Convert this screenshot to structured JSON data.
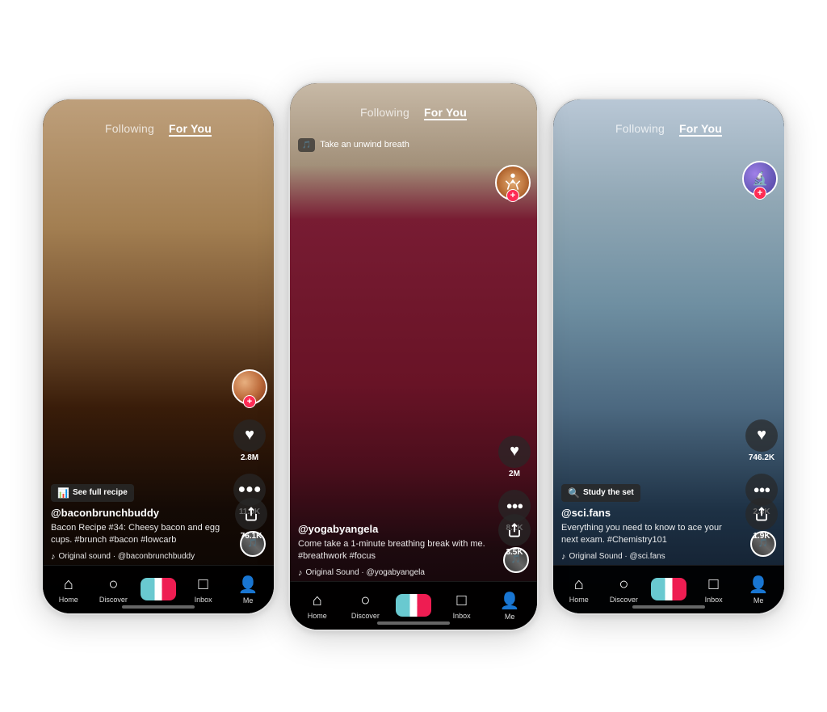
{
  "phones": [
    {
      "id": "phone-left",
      "theme": "egg",
      "nav": {
        "following": "Following",
        "for_you": "For You",
        "active": "for_you"
      },
      "sidebar": {
        "likes": "2.8M",
        "comments": "11.0K",
        "shares": "76.1K"
      },
      "content": {
        "badge": "See full recipe",
        "username": "@baconbrunchbuddy",
        "description": "Bacon Recipe #34: Cheesy bacon and egg cups. #brunch #bacon #lowcarb",
        "sound": "Original sound · @baconbrunchbuddy"
      },
      "bottomnav": [
        "Home",
        "Discover",
        "+",
        "Inbox",
        "Me"
      ]
    },
    {
      "id": "phone-middle",
      "theme": "yoga",
      "nav": {
        "following": "Following",
        "for_you": "For You",
        "active": "for_you"
      },
      "breathe": "Take an unwind breath",
      "sidebar": {
        "likes": "2M",
        "comments": "8.1K",
        "shares": "3.5K"
      },
      "content": {
        "username": "@yogabyangela",
        "description": "Come take a 1-minute breathing break with me. #breathwork #focus",
        "sound": "Original Sound · @yogabyangela"
      },
      "bottomnav": [
        "Home",
        "Discover",
        "+",
        "Inbox",
        "Me"
      ]
    },
    {
      "id": "phone-right",
      "theme": "chemistry",
      "nav": {
        "following": "Following",
        "for_you": "For You",
        "active": "for_you"
      },
      "sidebar": {
        "likes": "746.2K",
        "comments": "2.8K",
        "shares": "1.9K"
      },
      "content": {
        "badge": "Study the set",
        "username": "@sci.fans",
        "description": "Everything you need to know to ace your next exam. #Chemistry101",
        "sound": "Original Sound · @sci.fans"
      },
      "bottomnav": [
        "Home",
        "Discover",
        "+",
        "Inbox",
        "Me"
      ]
    }
  ],
  "icons": {
    "home": "🏠",
    "discover": "🔍",
    "inbox": "💬",
    "me": "👤",
    "heart": "♥",
    "comment": "···",
    "share": "↗",
    "music": "♪",
    "badge_recipe": "📊",
    "badge_study": "🔍",
    "breath": "🎵"
  },
  "colors": {
    "tiktok_red": "#fe2c55",
    "tiktok_cyan": "#69c9d0",
    "active_underline": "#ffffff",
    "nav_bg": "rgba(0,0,0,0.92)"
  }
}
